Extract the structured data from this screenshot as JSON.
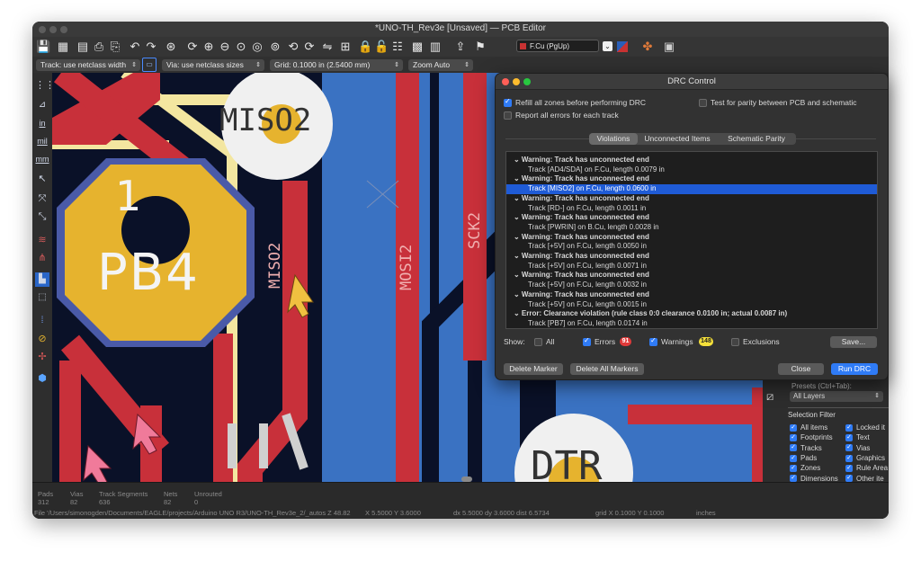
{
  "window": {
    "title": "*UNO-TH_Rev3e [Unsaved] — PCB Editor"
  },
  "toolbar": {
    "icons": [
      "save-icon",
      "board-setup-icon",
      "page-setup-icon",
      "print-icon",
      "plot-icon",
      "undo-icon",
      "redo-icon",
      "find-icon",
      "refresh-icon",
      "zoom-in-icon",
      "zoom-out-icon",
      "zoom-fit-icon",
      "zoom-objects-icon",
      "zoom-selection-icon",
      "rotate-ccw-icon",
      "rotate-cw-icon",
      "flip-icon",
      "align-icon",
      "lock-icon",
      "unlock-icon",
      "netlist-icon",
      "footprint-editor-icon",
      "footprint-browser-icon",
      "update-pcb-icon",
      "drc-icon"
    ],
    "layer_select": "F.Cu (PgUp)"
  },
  "toolbar2": {
    "track": "Track: use netclass width",
    "via": "Via: use netclass sizes",
    "grid": "Grid: 0.1000 in (2.5400 mm)",
    "zoom": "Zoom Auto"
  },
  "left_toolbar": {
    "in": "in",
    "mil": "mil",
    "mm": "mm"
  },
  "canvas": {
    "pad_number": "1",
    "pad_name": "PB4",
    "labels": {
      "miso2_pad": "MISO2",
      "miso2_track": "MISO2",
      "mosi2": "MOSI2",
      "sck2": "SCK2",
      "dtr": "DTR"
    }
  },
  "drc": {
    "title": "DRC Control",
    "refill": "Refill all zones before performing DRC",
    "report_all": "Report all errors for each track",
    "parity": "Test for parity between PCB and schematic",
    "tabs": [
      "Violations",
      "Unconnected Items",
      "Schematic Parity"
    ],
    "rows": [
      {
        "type": "hd",
        "text": "Warning: Track has unconnected end"
      },
      {
        "type": "it",
        "text": "Track [AD4/SDA] on F.Cu, length 0.0079 in"
      },
      {
        "type": "hd",
        "text": "Warning: Track has unconnected end"
      },
      {
        "type": "sel",
        "text": "Track [MISO2] on F.Cu, length 0.0600 in"
      },
      {
        "type": "hd",
        "text": "Warning: Track has unconnected end"
      },
      {
        "type": "it",
        "text": "Track [RD-] on F.Cu, length 0.0011 in"
      },
      {
        "type": "hd",
        "text": "Warning: Track has unconnected end"
      },
      {
        "type": "it",
        "text": "Track [PWRIN] on B.Cu, length 0.0028 in"
      },
      {
        "type": "hd",
        "text": "Warning: Track has unconnected end"
      },
      {
        "type": "it",
        "text": "Track [+5V] on F.Cu, length 0.0050 in"
      },
      {
        "type": "hd",
        "text": "Warning: Track has unconnected end"
      },
      {
        "type": "it",
        "text": "Track [+5V] on F.Cu, length 0.0071 in"
      },
      {
        "type": "hd",
        "text": "Warning: Track has unconnected end"
      },
      {
        "type": "it",
        "text": "Track [+5V] on F.Cu, length 0.0032 in"
      },
      {
        "type": "hd",
        "text": "Warning: Track has unconnected end"
      },
      {
        "type": "it",
        "text": "Track [+5V] on F.Cu, length 0.0015 in"
      },
      {
        "type": "hd",
        "text": "Error: Clearance violation (rule class 0:0 clearance 0.0100 in; actual 0.0087 in)"
      },
      {
        "type": "it",
        "text": "Track [PB7] on F.Cu, length 0.0174 in"
      }
    ],
    "show_label": "Show:",
    "all": "All",
    "errors": "Errors",
    "errors_count": "91",
    "warnings": "Warnings",
    "warnings_count": "148",
    "exclusions": "Exclusions",
    "save": "Save...",
    "delete_marker": "Delete Marker",
    "delete_all": "Delete All Markers",
    "close": "Close",
    "run": "Run DRC"
  },
  "right_panel": {
    "presets_label": "Presets (Ctrl+Tab):",
    "presets_value": "All Layers",
    "selection_filter": "Selection Filter",
    "filters": [
      [
        "All items",
        "Locked it"
      ],
      [
        "Footprints",
        "Text"
      ],
      [
        "Tracks",
        "Vias"
      ],
      [
        "Pads",
        "Graphics"
      ],
      [
        "Zones",
        "Rule Area"
      ],
      [
        "Dimensions",
        "Other ite"
      ]
    ]
  },
  "status": {
    "pads_label": "Pads",
    "pads": "312",
    "vias_label": "Vias",
    "vias": "82",
    "segments_label": "Track Segments",
    "segments": "636",
    "nets_label": "Nets",
    "nets": "82",
    "unrouted_label": "Unrouted",
    "unrouted": "0",
    "file": "File '/Users/simonogden/Documents/EAGLE/projects/Arduino UNO R3/UNO-TH_Rev3e_2/_autos Z 48.82",
    "xy": "X 5.5000  Y 3.6000",
    "dxy": "dx 5.5000  dy 3.6000  dist 6.5734",
    "grid": "grid X 0.1000  Y 0.1000",
    "units": "inches"
  },
  "colors": {
    "track_red": "#c8303a",
    "pad_yellow": "#e6b32e",
    "back_blue": "#3a72c2",
    "selection": "#1f5bd6",
    "accent": "#2f7bf6"
  }
}
